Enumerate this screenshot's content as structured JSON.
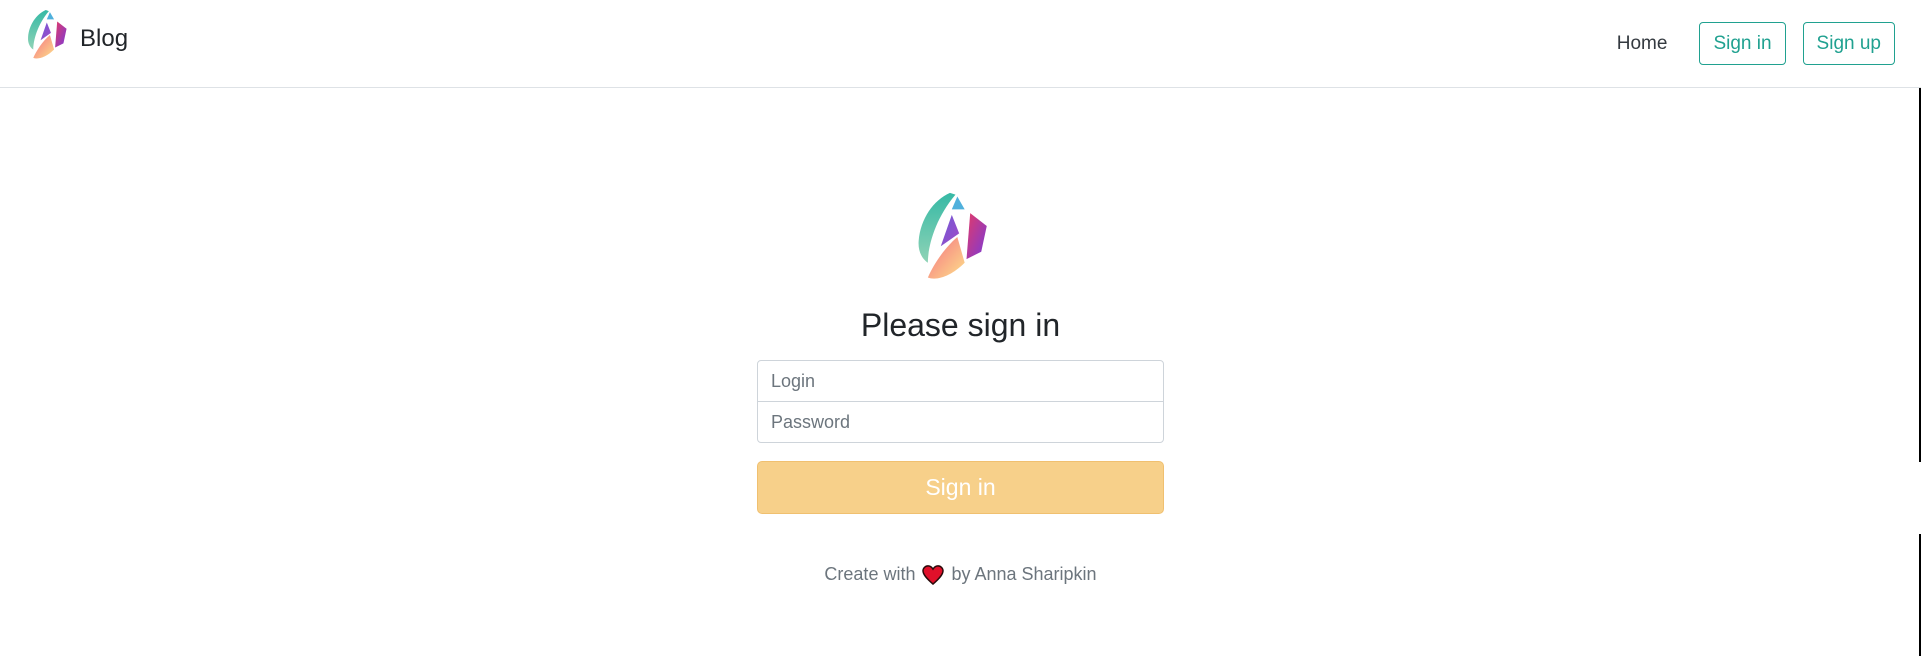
{
  "navbar": {
    "brand": {
      "logo_icon": "brand-logo-icon",
      "text": "Blog"
    },
    "links": {
      "home": "Home"
    },
    "buttons": {
      "sign_in": "Sign in",
      "sign_up": "Sign up"
    },
    "accent_color": "#20a190"
  },
  "form": {
    "logo_icon": "brand-logo-icon",
    "title": "Please sign in",
    "login_placeholder": "Login",
    "password_placeholder": "Password",
    "submit_label": "Sign in",
    "submit_color": "#f7d08a"
  },
  "footer": {
    "prefix": "Create with",
    "icon": "heart-icon",
    "suffix": "by Anna Sharipkin",
    "heart_color": "#e0102a"
  }
}
